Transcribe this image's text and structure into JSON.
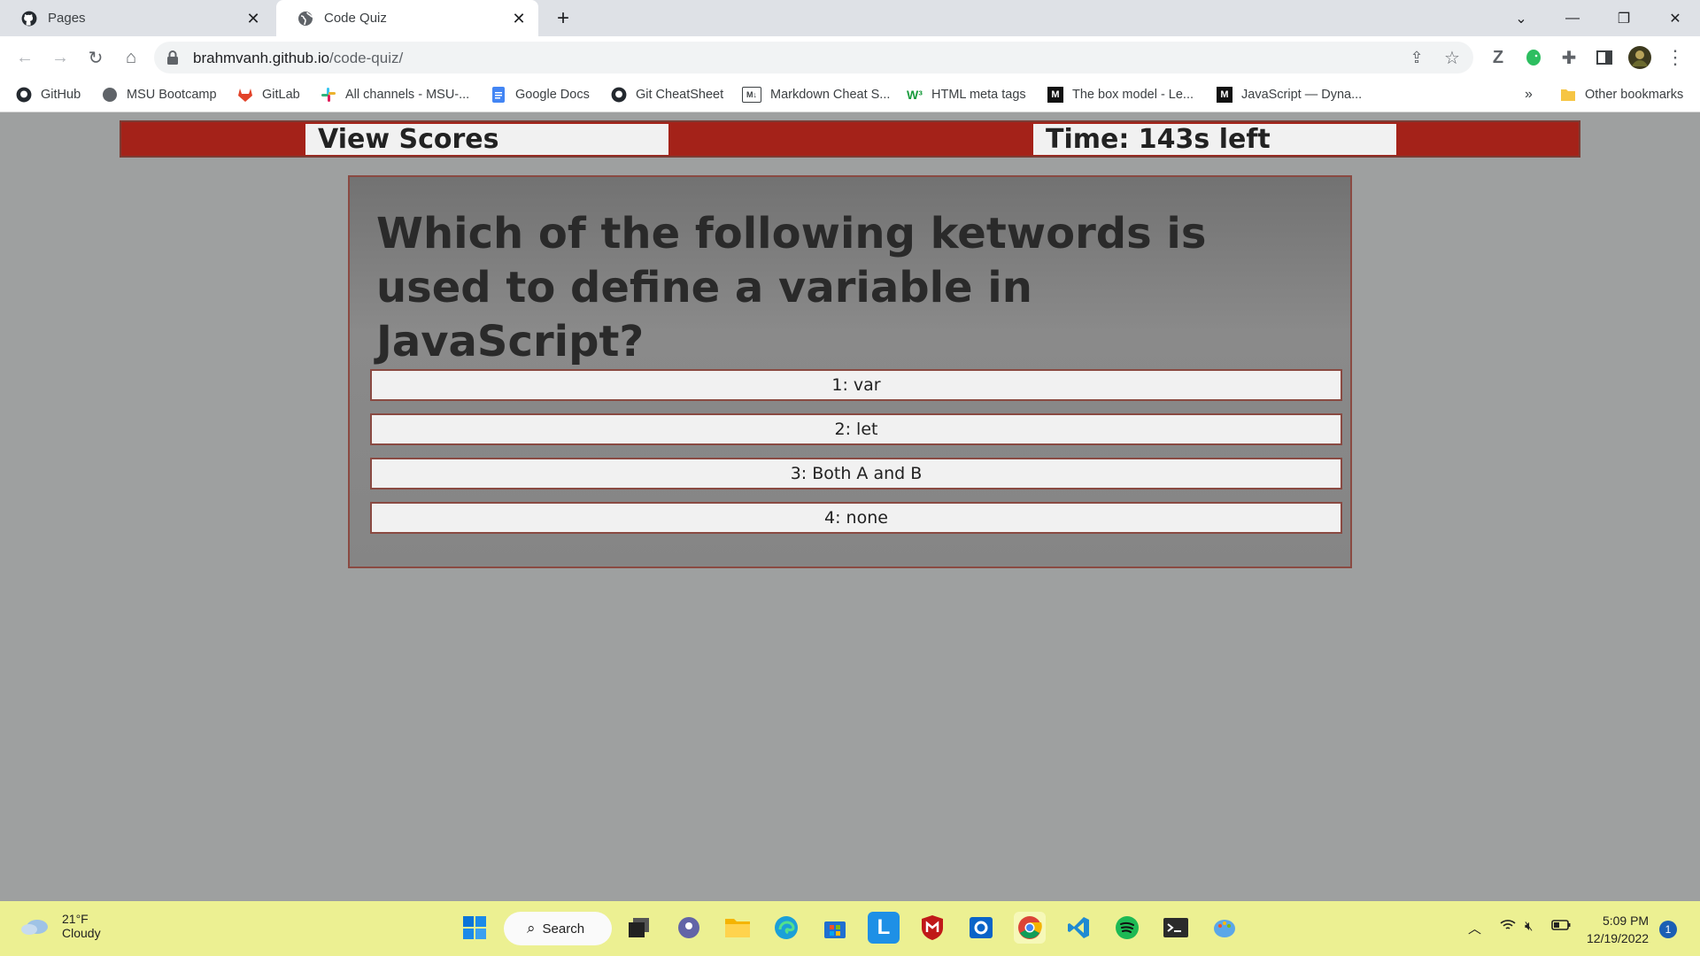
{
  "browser": {
    "tabs": [
      {
        "title": "Pages",
        "icon": "github-icon",
        "active": false
      },
      {
        "title": "Code Quiz",
        "icon": "globe-icon",
        "active": true
      }
    ],
    "new_tab": "+",
    "url_host": "brahmvanh.github.io",
    "url_path": "/code-quiz/",
    "bookmarks": [
      {
        "label": "GitHub",
        "icon": "github-icon"
      },
      {
        "label": "MSU Bootcamp",
        "icon": "globe-icon"
      },
      {
        "label": "GitLab",
        "icon": "gitlab-icon"
      },
      {
        "label": "All channels - MSU-...",
        "icon": "slack-icon"
      },
      {
        "label": "Google Docs",
        "icon": "google-docs-icon"
      },
      {
        "label": "Git CheatSheet",
        "icon": "github-icon"
      },
      {
        "label": "Markdown Cheat S...",
        "icon": "markdown-icon"
      },
      {
        "label": "HTML meta tags",
        "icon": "w3-icon"
      },
      {
        "label": "The box model - Le...",
        "icon": "mdn-icon"
      },
      {
        "label": "JavaScript — Dyna...",
        "icon": "mdn-icon"
      }
    ],
    "bookmarks_overflow": "»",
    "other_bookmarks": "Other bookmarks"
  },
  "quiz": {
    "view_scores": "View Scores",
    "timer": "Time: 143s left",
    "question": "Which of the following ketwords is used to define a variable in JavaScript?",
    "answers": [
      "1: var",
      "2: let",
      "3: Both A and B",
      "4: none"
    ],
    "colors": {
      "header": "#a42219",
      "page_bg": "#9ea0a0",
      "card_border": "#8a4a42"
    }
  },
  "taskbar": {
    "temperature": "21°F",
    "condition": "Cloudy",
    "search_label": "Search",
    "time": "5:09 PM",
    "date": "12/19/2022",
    "notification_count": "1",
    "color": "#ecf092"
  }
}
